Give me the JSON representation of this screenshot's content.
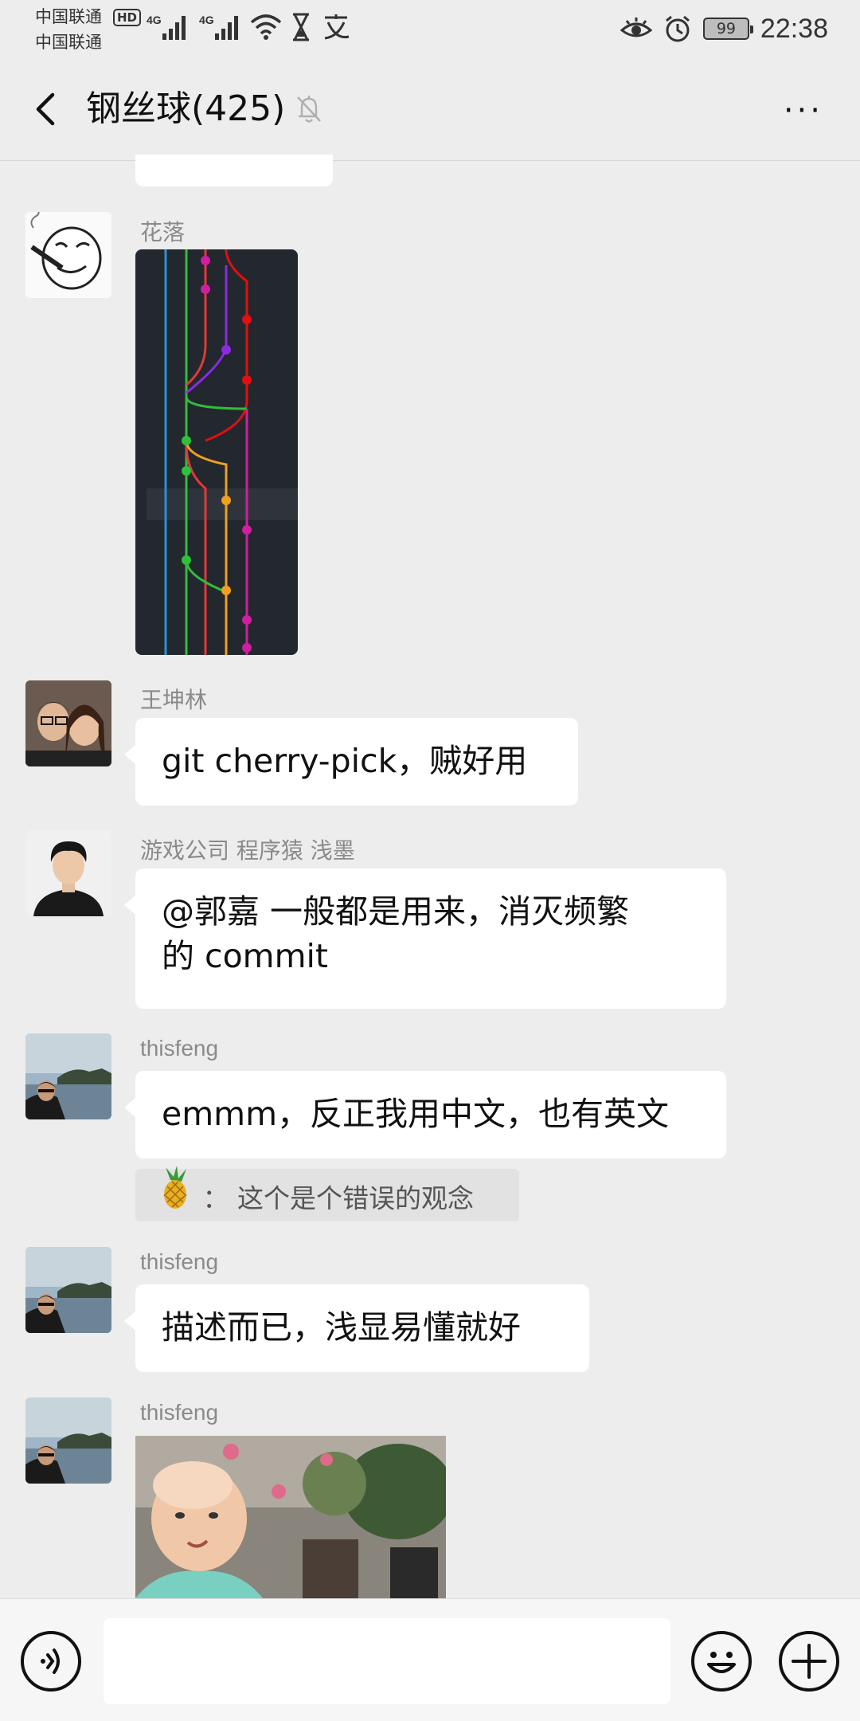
{
  "status_bar": {
    "carrier_1": "中国联通",
    "carrier_2": "中国联通",
    "hd_badge": "HD",
    "net_1": "4G",
    "net_2": "4G",
    "battery": "99",
    "time": "22:38"
  },
  "header": {
    "title": "钢丝球(425)",
    "more": "···"
  },
  "messages": [
    {
      "sender": "花落",
      "type": "image"
    },
    {
      "sender": "王坤林",
      "text": "git  cherry-pick，贼好用"
    },
    {
      "sender": "游戏公司 程序猿 浅墨",
      "line1": "@郭嘉  一般都是用来，消灭频繁",
      "line2": "的 commit"
    },
    {
      "sender": "thisfeng",
      "text": "emmm，反正我用中文，也有英文",
      "quote_sep": "：",
      "quote": "这个是个错误的观念"
    },
    {
      "sender": "thisfeng",
      "text": "描述而已，浅显易懂就好"
    },
    {
      "sender": "thisfeng",
      "type": "image"
    }
  ]
}
